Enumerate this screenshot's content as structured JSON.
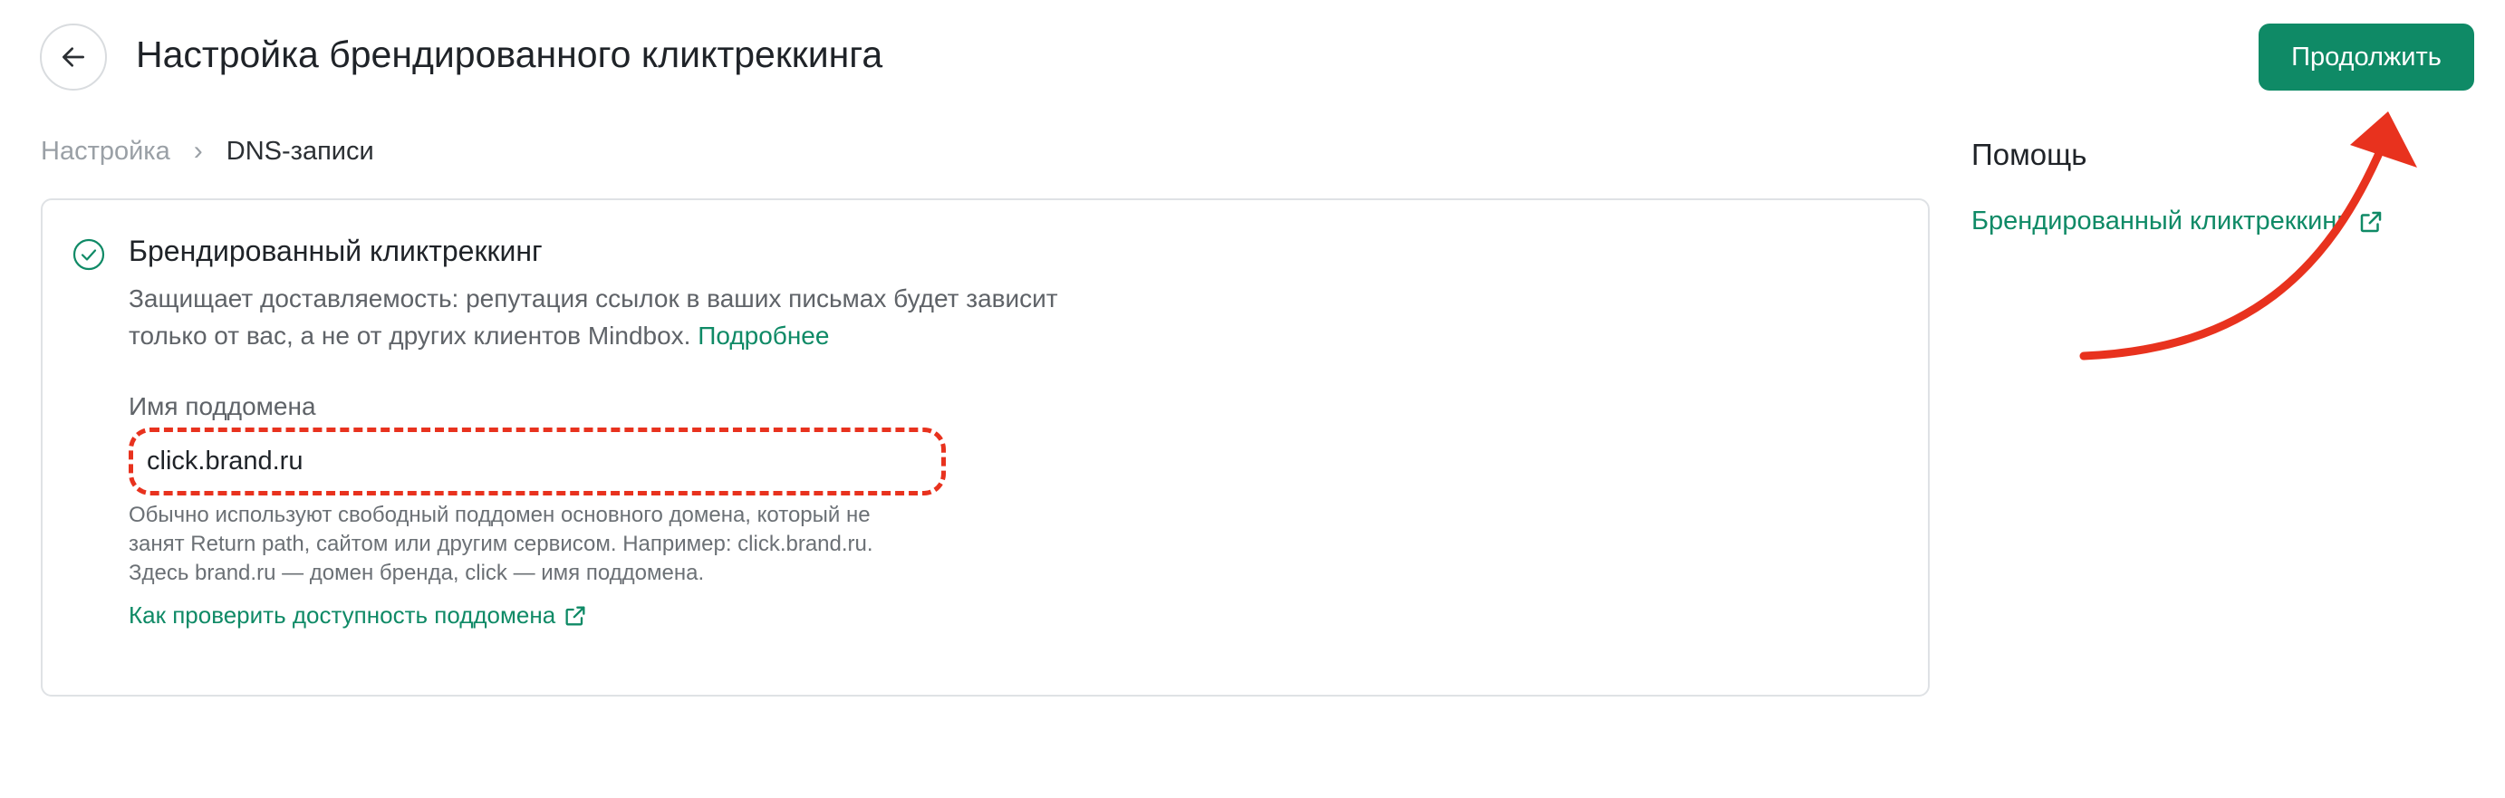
{
  "header": {
    "title": "Настройка брендированного кликтреккинга",
    "continue_label": "Продолжить"
  },
  "breadcrumb": {
    "parent": "Настройка",
    "separator": "›",
    "current": "DNS-записи"
  },
  "card": {
    "title": "Брендированный кликтреккинг",
    "description_line1": "Защищает доставляемость: репутация ссылок в ваших письмах будет зависит",
    "description_line2": "только от вас, а не от других клиентов Mindbox.",
    "more_link": "Подробнее",
    "field_label": "Имя поддомена",
    "field_value": "click.brand.ru",
    "hint_line1": "Обычно используют свободный поддомен основного домена, который не",
    "hint_line2": "занят Return path, сайтом или другим сервисом. Например: click.brand.ru.",
    "hint_line3": "Здесь brand.ru — домен бренда, click — имя поддомена.",
    "check_link": "Как проверить доступность поддомена"
  },
  "help": {
    "title": "Помощь",
    "link": "Брендированный кликтреккинг"
  },
  "icons": {
    "back": "arrow-left-icon",
    "status": "check-circle-icon",
    "external": "external-link-icon"
  },
  "colors": {
    "accent": "#0f8a66",
    "annotation": "#e8321e"
  }
}
